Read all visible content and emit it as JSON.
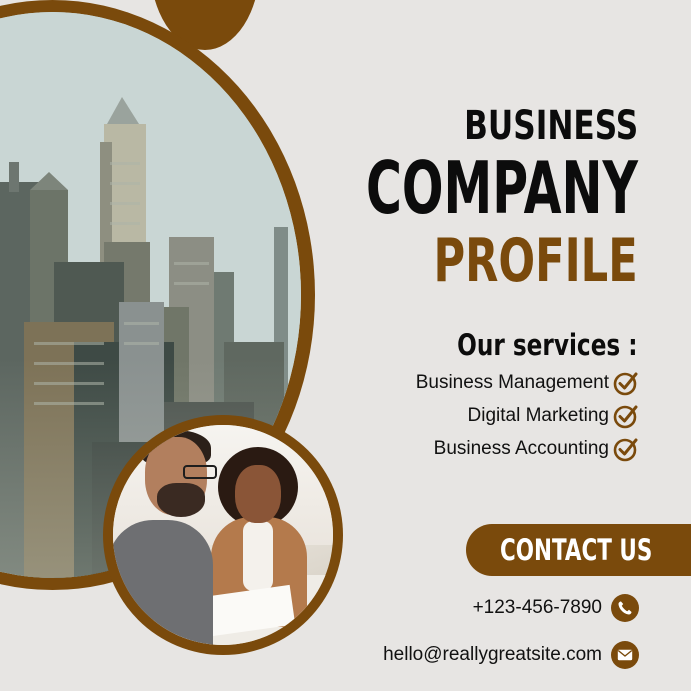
{
  "title": {
    "line1": "BUSINESS",
    "line2": "COMPANY",
    "line3": "PROFILE"
  },
  "services": {
    "heading": "Our services :",
    "items": [
      {
        "label": "Business Management",
        "icon": "check-circle-icon"
      },
      {
        "label": "Digital Marketing",
        "icon": "check-circle-icon"
      },
      {
        "label": "Business Accounting",
        "icon": "check-circle-icon"
      }
    ]
  },
  "contact": {
    "cta_label": "CONTACT US",
    "phone": "+123-456-7890",
    "phone_icon": "phone-icon",
    "email": "hello@reallygreatsite.com",
    "email_icon": "envelope-icon"
  },
  "colors": {
    "accent_brown": "#7a4a0c",
    "background": "#e7e5e3",
    "text_dark": "#0c0c0c"
  }
}
